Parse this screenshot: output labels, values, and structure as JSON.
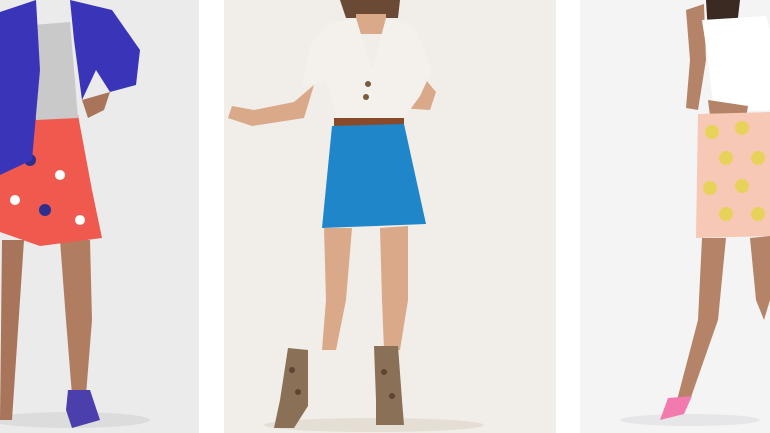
{
  "products": [
    {
      "image_alt": "",
      "favorite_icon": "heart-icon"
    },
    {
      "image_alt": "",
      "favorite_icon": "heart-icon"
    },
    {
      "image_alt": "",
      "favorite_icon": "heart-icon"
    }
  ],
  "colors": {
    "card_1_bg": "#ebebeb",
    "card_2_bg": "#f1eee9",
    "card_3_bg": "#f4f4f5",
    "denim_jacket": "#3a35b8",
    "floral_skirt": "#f05a4e",
    "blue_skirt": "#1e86c9",
    "polka_skirt": "#f6c8b5",
    "polka_dots": "#e8d35a",
    "pink_heels": "#f27aae"
  }
}
